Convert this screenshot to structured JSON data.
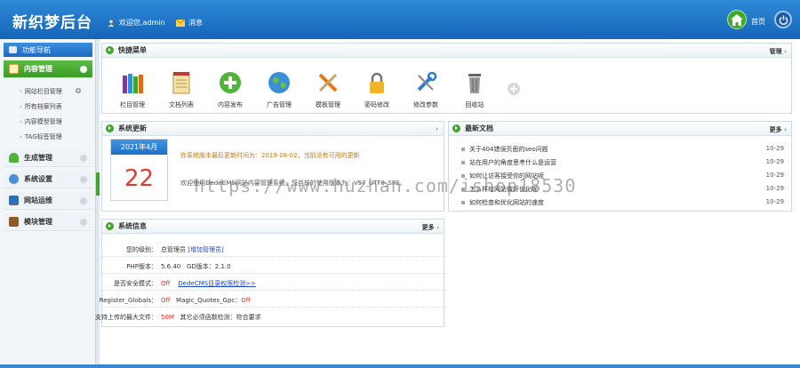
{
  "header": {
    "logo": "新织梦后台",
    "welcome": "欢迎您,admin",
    "messages": "消息",
    "home": "首页"
  },
  "sidebar": {
    "title": "功能导航",
    "menus": [
      {
        "label": "内容管理",
        "icon": "pencil-icon"
      },
      {
        "label": "生成管理",
        "icon": "tree-icon"
      },
      {
        "label": "系统设置",
        "icon": "gears-icon"
      },
      {
        "label": "网站运维",
        "icon": "monitor-icon"
      },
      {
        "label": "模块管理",
        "icon": "book-icon"
      }
    ],
    "subitems": [
      "网站栏目管理",
      "所有档案列表",
      "内容模型管理",
      "TAG标签管理"
    ]
  },
  "quick": {
    "title": "快捷菜单",
    "manage": "管理",
    "items": [
      {
        "label": "栏目管理",
        "icon": "books-icon"
      },
      {
        "label": "文档列表",
        "icon": "notepad-icon"
      },
      {
        "label": "内容发布",
        "icon": "add-circle-icon"
      },
      {
        "label": "广告管理",
        "icon": "globe-icon"
      },
      {
        "label": "模板管理",
        "icon": "tools-icon"
      },
      {
        "label": "密码修改",
        "icon": "lock-icon"
      },
      {
        "label": "修改参数",
        "icon": "wrench-icon"
      },
      {
        "label": "回收站",
        "icon": "trash-icon"
      }
    ]
  },
  "update": {
    "title": "系统更新",
    "month": "2021年4月",
    "day": "22",
    "line1": "你系统版本最后更新时间为：2019-08-02，当前没有可用的更新",
    "line2": "欢迎使用DedeCMS网站内容管理系统，您当前的使用版本为：V57_UTF8_SP2。"
  },
  "news": {
    "title": "最新文档",
    "more": "更多",
    "items": [
      {
        "title": "关于404错误页面的seo问题",
        "date": "10-29"
      },
      {
        "title": "站在用户的角度思考什么是运营",
        "date": "10-29"
      },
      {
        "title": "如何让访客接受你的网站呢",
        "date": "10-29"
      },
      {
        "title": "怎么样给网站做好优化呢",
        "date": "10-29"
      },
      {
        "title": "如何检查和优化网站的速度",
        "date": "10-29"
      }
    ]
  },
  "sysinfo": {
    "title": "系统信息",
    "more": "更多",
    "level_label": "您的级别：",
    "level_value": "总管理员",
    "level_link": "[增加管理员]",
    "php_label": "PHP版本：",
    "php_value": "5.6.40",
    "gd_label": "GD版本：",
    "gd_value": "2.1.0",
    "safe_label": "是否安全模式：",
    "safe_value": "Off",
    "safe_link": "DedeCMS目录权限检测>>",
    "rg_label": "Register_Globals：",
    "rg_value": "Off",
    "mq_label": "Magic_Quotes_Gpc：",
    "mq_value": "Off",
    "upload_label": "支持上传的最大文件：",
    "upload_value": "50M",
    "func_label": "其它必须函数检测：",
    "func_value": "符合要求"
  },
  "watermark": "https://www.huzhan.com/ishop18530",
  "colors": {
    "header": "#1f73c6",
    "accent_green": "#3ea62a",
    "red": "#e8261e"
  }
}
